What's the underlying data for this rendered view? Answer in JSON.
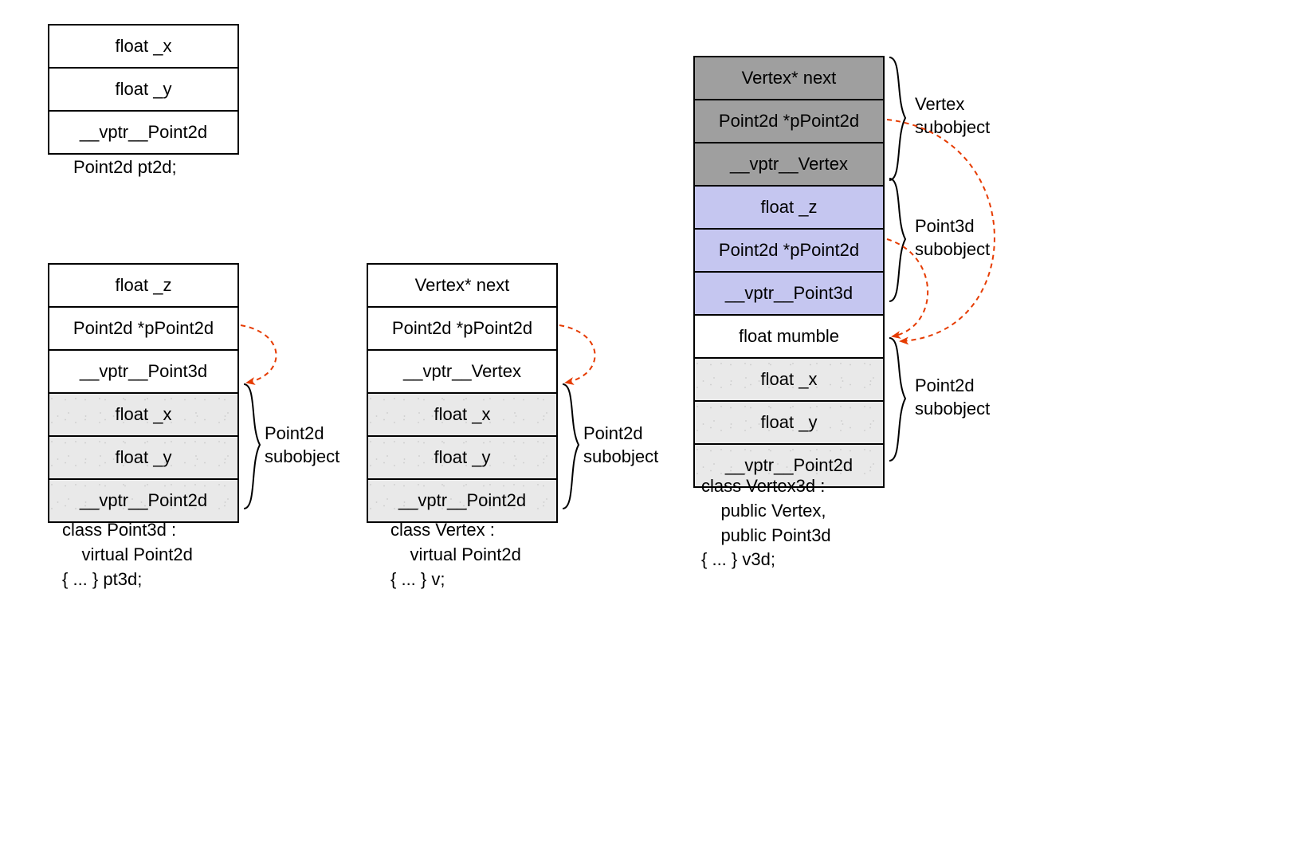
{
  "pt2d": {
    "rows": [
      "float _x",
      "float _y",
      "__vptr__Point2d"
    ],
    "caption": "Point2d pt2d;"
  },
  "pt3d": {
    "rows": [
      "float _z",
      "Point2d *pPoint2d",
      "__vptr__Point3d",
      "float _x",
      "float _y",
      "__vptr__Point2d"
    ],
    "caption": "class Point3d :\n    virtual Point2d\n{ ... } pt3d;",
    "sub1": "Point2d\nsubobject"
  },
  "vertex": {
    "rows": [
      "Vertex* next",
      "Point2d *pPoint2d",
      "__vptr__Vertex",
      "float _x",
      "float _y",
      "__vptr__Point2d"
    ],
    "caption": "class Vertex :\n    virtual Point2d\n{ ... } v;",
    "sub1": "Point2d\nsubobject"
  },
  "v3d": {
    "rows": [
      "Vertex* next",
      "Point2d *pPoint2d",
      "__vptr__Vertex",
      "float _z",
      "Point2d *pPoint2d",
      "__vptr__Point3d",
      "float mumble",
      "float _x",
      "float _y",
      "__vptr__Point2d"
    ],
    "caption": "class Vertex3d :\n    public Vertex,\n    public Point3d\n{ ... } v3d;",
    "sub_vertex": "Vertex\nsubobject",
    "sub_p3d": "Point3d\nsubobject",
    "sub_p2d": "Point2d\nsubobject"
  }
}
